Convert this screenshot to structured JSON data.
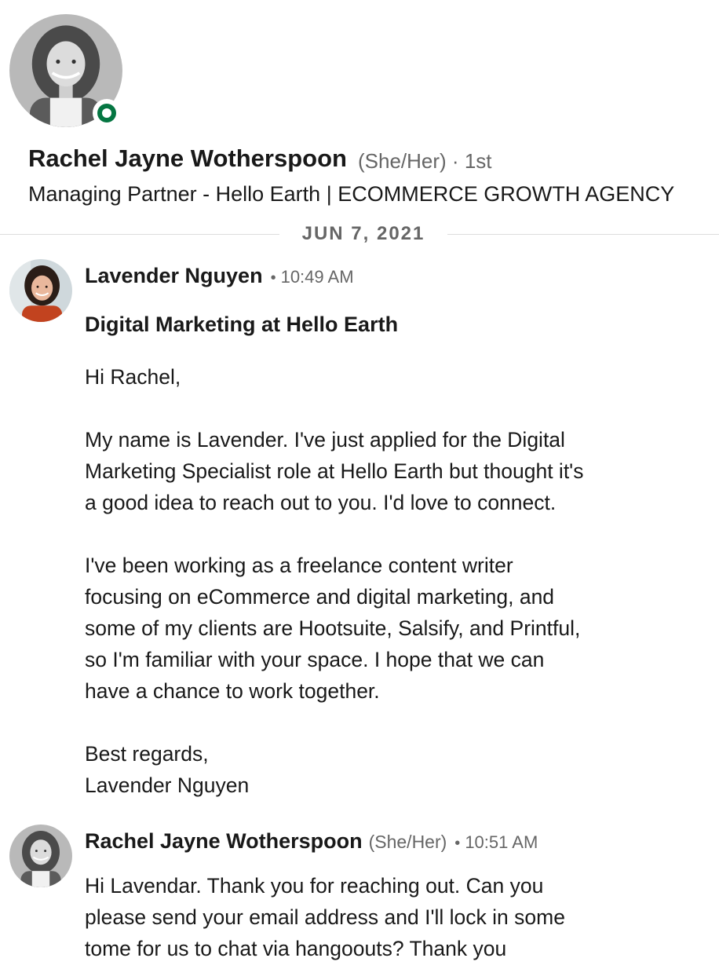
{
  "profile": {
    "name": "Rachel Jayne Wotherspoon",
    "pronouns": "(She/Her)",
    "connection": "1st",
    "headline": "Managing Partner - Hello Earth | ECOMMERCE GROWTH AGENCY",
    "avatar_icon": "profile-photo",
    "presence_status": "online",
    "presence_color": "#057642"
  },
  "thread": {
    "date": "JUN 7, 2021",
    "messages": [
      {
        "sender": "Lavender Nguyen",
        "time": "10:49 AM",
        "subject": "Digital Marketing at Hello Earth",
        "lines": [
          "Hi Rachel,",
          "",
          "My name is Lavender. I've just applied for the Digital",
          "Marketing Specialist role at Hello Earth but thought it's",
          "a good idea to reach out to you. I'd love to connect.",
          "",
          "I've been working as a freelance content writer",
          "focusing on eCommerce and digital marketing, and",
          "some of my clients are Hootsuite, Salsify, and Printful,",
          "so I'm familiar with your space. I hope that we can",
          "have a chance to work together.",
          "",
          "Best regards,",
          "Lavender Nguyen"
        ]
      },
      {
        "sender": "Rachel Jayne Wotherspoon",
        "pronouns": "(She/Her)",
        "time": "10:51 AM",
        "lines": [
          "Hi Lavendar. Thank you for reaching out. Can you",
          "please send your email address and I'll lock in some",
          "tome for us to chat via hangoouts? Thank you"
        ]
      }
    ]
  }
}
